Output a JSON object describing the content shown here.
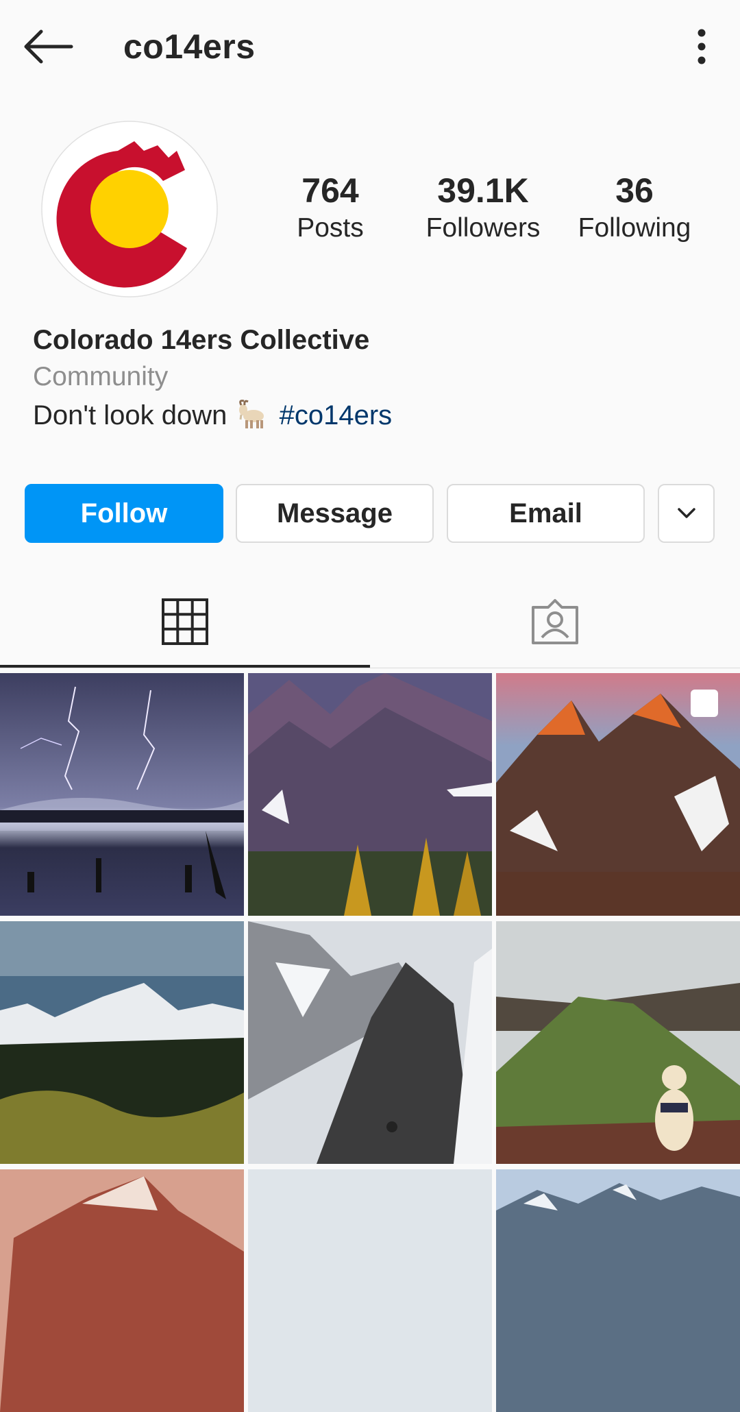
{
  "header": {
    "username": "co14ers"
  },
  "stats": {
    "posts": {
      "value": "764",
      "label": "Posts"
    },
    "followers": {
      "value": "39.1K",
      "label": "Followers"
    },
    "following": {
      "value": "36",
      "label": "Following"
    }
  },
  "bio": {
    "name": "Colorado 14ers Collective",
    "category": "Community",
    "text": "Don't look down",
    "emoji": "🐐",
    "hashtag": "#co14ers"
  },
  "actions": {
    "follow": "Follow",
    "message": "Message",
    "email": "Email"
  },
  "colors": {
    "follow_blue": "#0095f6",
    "hashtag": "#00376b",
    "flag_red": "#c8102e",
    "flag_gold": "#ffd100"
  },
  "posts": [
    {
      "subject": "lightning-storm-over-lake",
      "multi": false
    },
    {
      "subject": "maroon-bells-peaks",
      "multi": false
    },
    {
      "subject": "sunrise-alpenglow-peaks",
      "multi": true
    },
    {
      "subject": "snowy-range-golden-hills",
      "multi": false
    },
    {
      "subject": "rocky-ridge-climber",
      "multi": false
    },
    {
      "subject": "green-ridge-with-dog",
      "multi": false
    },
    {
      "subject": "red-peak-sunset",
      "multi": false
    },
    {
      "subject": "misty-sky",
      "multi": false
    },
    {
      "subject": "distant-mountain-range",
      "multi": false
    }
  ]
}
